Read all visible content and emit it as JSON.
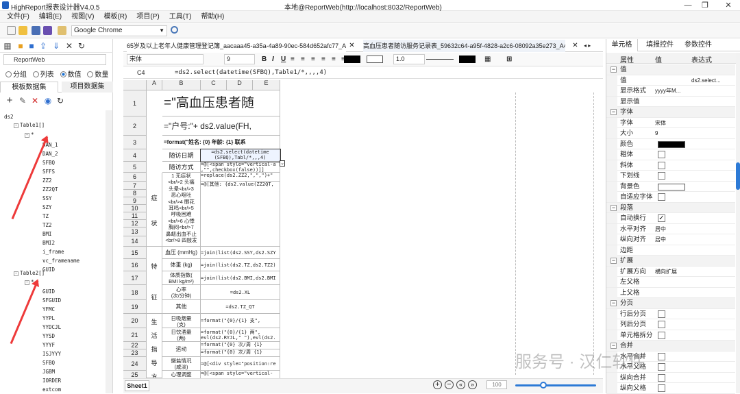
{
  "window": {
    "app_title": "HighReport报表设计器V4.0.5",
    "center_title": "本地@ReportWeb(http://localhost:8032/ReportWeb)"
  },
  "menu": [
    "文件(F)",
    "编辑(E)",
    "视图(V)",
    "模板(R)",
    "项目(P)",
    "工具(T)",
    "帮助(H)"
  ],
  "toolbar": {
    "browser": "Google Chrome"
  },
  "left": {
    "project": "ReportWeb",
    "radios": [
      {
        "label": "分组",
        "checked": false
      },
      {
        "label": "列表",
        "checked": false
      },
      {
        "label": "数值",
        "checked": true
      },
      {
        "label": "数量",
        "checked": false
      }
    ],
    "tabs": [
      "模板数据集",
      "项目数据集"
    ],
    "tree": {
      "root": "ds2",
      "table1": "Table1[]",
      "star": "*",
      "table1_fields": [
        "DAN_1",
        "DAN_2",
        "SFBQ",
        "SFFS",
        "ZZ2",
        "ZZ2QT",
        "SSY",
        "SZY",
        "TZ",
        "TZ2",
        "BMI",
        "BMI2",
        "i_frame",
        "vc_framename",
        "GUID"
      ],
      "table2": "Table2[]",
      "table2_fields": [
        "GUID",
        "SFGUID",
        "YFMC",
        "YYPL",
        "YYDCJL",
        "YYSD",
        "YYYF",
        "ISJYYY",
        "SFBQ",
        "JGBM",
        "IORDER",
        "extcom"
      ]
    }
  },
  "doc_tabs": [
    "65岁及以上老年人健康管理登记簿_aacaaa45-a35a-4a89-90ec-584d652afc77_A4.cpf",
    "高血压患者随访服务记录表_59632c64-a95f-4828-a2c6-08092a35e273_A4.cpf"
  ],
  "format": {
    "font": "宋体",
    "size": "9",
    "line_width": "1.0"
  },
  "formula": {
    "cell": "C4",
    "text": "=ds2.select(datetime(SFBQ),Table1/*,,,,4)"
  },
  "sheet": {
    "cols": [
      "A",
      "B",
      "C",
      "D",
      "E"
    ],
    "rows": [
      "1",
      "2",
      "3",
      "4",
      "5",
      "6",
      "7",
      "8",
      "9",
      "10",
      "11",
      "12",
      "13",
      "14",
      "15",
      "16",
      "17",
      "18",
      "19",
      "20",
      "21",
      "22",
      "23",
      "24",
      "25"
    ],
    "title": "=\"高血压患者随",
    "r2": "=\"户号:\"+ ds2.value(FH,",
    "r3": "=format(\"姓名: {0}  年龄: {1}  联系",
    "r4b": "随访日期",
    "r4c": "=ds2.select(datetime",
    "r4c2": "(SFBQ),Tabl/*,,,4)",
    "r5b": "随访方式",
    "r5c": "=@[<span style=\"vertical-a",
    "r5c2": ",\"\",checkbox(false))]]",
    "r6a": "症",
    "r9a": "状",
    "r6b": [
      "1 无症状",
      "<br/>2 头痛",
      "头晕<br/>3",
      "恶心呕吐",
      "<br/>4 眼花",
      "耳鸣<br/>5",
      "呼吸困难",
      "<br/>6 心悸",
      "胸闷<br/>7",
      "鼻衄出血不止",
      "<br/>8 四肢发"
    ],
    "r6c": "=replace(ds2.ZZ2,\",\",\")+\"",
    "r7c": "=@[其他: {ds2.value(ZZ2QT,",
    "r15b": "血压 (mmHg)",
    "r15c": "=join(list(ds2.SSY,ds2.SZY",
    "r16a": "特",
    "r16b": "体重 (kg)",
    "r16c": "=join(list(ds2.TZ,ds2.TZ2)",
    "r17b": "体质指数(",
    "r17b2": "BMI kg/m²)",
    "r17c": "=join(list(ds2.BMI,ds2.BMI",
    "r18a": "征",
    "r18b": "心率",
    "r18b2": "(次/分钟)",
    "r18c": "=ds2.XL",
    "r19b": "其他",
    "r19c": "=ds2.TZ_QT",
    "r20a": "生",
    "r20b": "日吸烟量",
    "r20b2": "(支)",
    "r20c": "=format(\"{0}/{1}       支\",",
    "r21a": "活",
    "r21b": "日饮酒量",
    "r21b2": "(两)",
    "r21c": "=format(\"{0}/{1}       两\",",
    "r21c2": "evl(ds2.RYJL,\" \"),evl(ds2.",
    "r22a": "指",
    "r22b": "运动",
    "r22c": "=format(\"{0}  次/周    {1}",
    "r23c": "=format(\"{0}  次/周    {1}",
    "r23a": "导",
    "r24a": "方",
    "r24b": "摄盐情况",
    "r24b2": "(咸淡)",
    "r24c": "=@[<div style=\"position:re",
    "r25b": "心理调整",
    "r25c": "=@[<span style=\"vertical-",
    "sheet_tab": "Sheet1",
    "zoom": "100",
    "zoom_slider": 0.35
  },
  "right": {
    "tabs": [
      "单元格",
      "填报控件",
      "参数控件"
    ],
    "headers": [
      "属性",
      "值",
      "表达式"
    ],
    "rows": [
      {
        "type": "group",
        "name": "值"
      },
      {
        "type": "prop",
        "name": "值",
        "value": "",
        "expr": "ds2.select..."
      },
      {
        "type": "prop",
        "name": "显示格式",
        "value": "yyyy年M...",
        "expr": ""
      },
      {
        "type": "prop",
        "name": "显示值",
        "value": "",
        "expr": ""
      },
      {
        "type": "group",
        "name": "字体"
      },
      {
        "type": "prop",
        "name": "字体",
        "value": "宋体",
        "expr": ""
      },
      {
        "type": "prop",
        "name": "大小",
        "value": "9",
        "expr": ""
      },
      {
        "type": "color",
        "name": "颜色",
        "value": "#000000"
      },
      {
        "type": "check",
        "name": "粗体",
        "checked": false
      },
      {
        "type": "check",
        "name": "斜体",
        "checked": false
      },
      {
        "type": "check",
        "name": "下划线",
        "checked": false
      },
      {
        "type": "color",
        "name": "背景色",
        "value": "#ffffff"
      },
      {
        "type": "check",
        "name": "自适应字体",
        "checked": false
      },
      {
        "type": "group",
        "name": "段落"
      },
      {
        "type": "check",
        "name": "自动换行",
        "checked": true
      },
      {
        "type": "prop",
        "name": "水平对齐",
        "value": "居中",
        "expr": ""
      },
      {
        "type": "prop",
        "name": "纵向对齐",
        "value": "居中",
        "expr": ""
      },
      {
        "type": "prop",
        "name": "边距",
        "value": "",
        "expr": ""
      },
      {
        "type": "group",
        "name": "扩展"
      },
      {
        "type": "prop",
        "name": "扩展方向",
        "value": "横向扩展",
        "expr": ""
      },
      {
        "type": "prop",
        "name": "左父格",
        "value": "",
        "expr": ""
      },
      {
        "type": "prop",
        "name": "上父格",
        "value": "",
        "expr": ""
      },
      {
        "type": "group",
        "name": "分页"
      },
      {
        "type": "check",
        "name": "行后分页",
        "checked": false
      },
      {
        "type": "check",
        "name": "列后分页",
        "checked": false
      },
      {
        "type": "check",
        "name": "单元格拆分",
        "checked": false
      },
      {
        "type": "group",
        "name": "合并"
      },
      {
        "type": "check",
        "name": "水平合并",
        "checked": false
      },
      {
        "type": "check",
        "name": "水平父格",
        "checked": false
      },
      {
        "type": "check",
        "name": "纵向合并",
        "checked": false
      },
      {
        "type": "check",
        "name": "纵向父格",
        "checked": false
      }
    ]
  },
  "watermark": "服务号 · 汉仁软件"
}
